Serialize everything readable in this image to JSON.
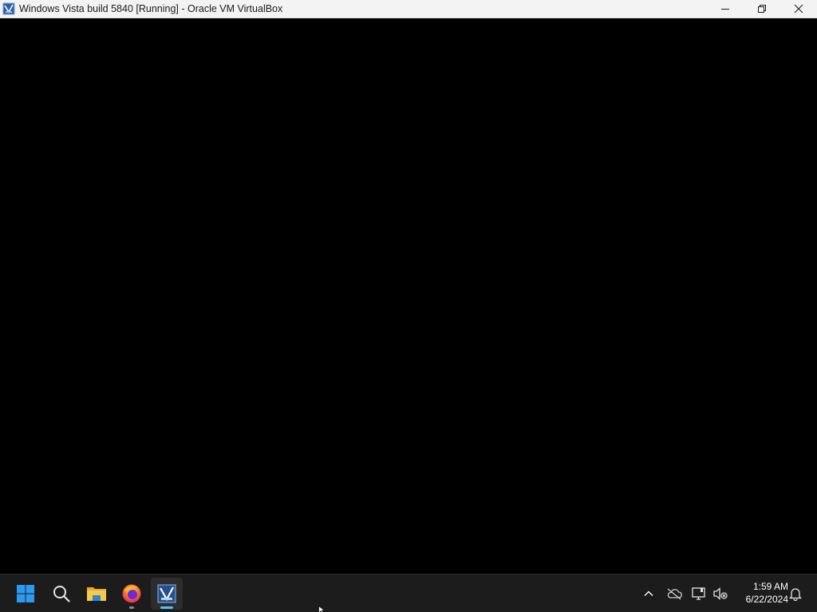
{
  "window": {
    "title": "Windows Vista build 5840 [Running] - Oracle VM VirtualBox",
    "icon": "virtualbox-vista-icon",
    "controls": {
      "minimize_icon": "minimize-icon",
      "restore_icon": "restore-icon",
      "close_icon": "close-icon"
    }
  },
  "vm_display": {
    "background": "#000000"
  },
  "taskbar": {
    "background": "#1c1c1c",
    "pinned": [
      {
        "name": "start",
        "icon": "windows-start-icon"
      },
      {
        "name": "search",
        "icon": "search-icon"
      },
      {
        "name": "file-explorer",
        "icon": "folder-icon"
      },
      {
        "name": "firefox",
        "icon": "firefox-icon",
        "state": "open"
      },
      {
        "name": "virtualbox",
        "icon": "virtualbox-vista-icon",
        "state": "focused"
      }
    ],
    "tray": {
      "icons": [
        "chevron-up-icon",
        "onedrive-offline-icon",
        "network-icon",
        "volume-muted-icon"
      ],
      "time": "1:59 AM",
      "date": "6/22/2024",
      "notification_icon": "bell-icon"
    }
  },
  "colors": {
    "accent": "#4cc2ff",
    "start_blue": "#1e90ff",
    "folder_yellow": "#f7c948"
  }
}
